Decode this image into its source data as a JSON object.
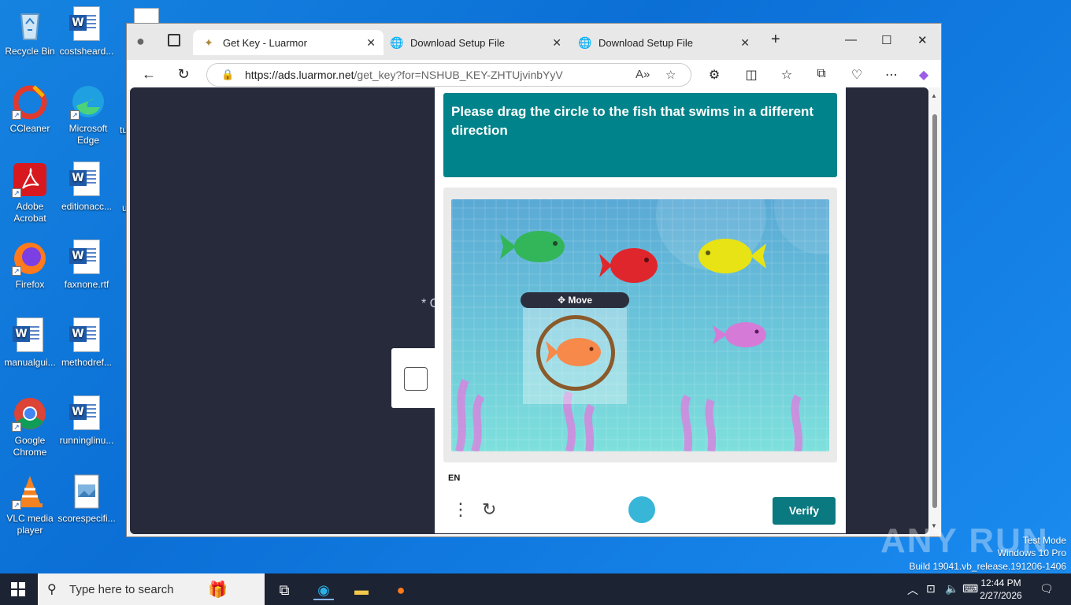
{
  "desktop": {
    "icons": [
      {
        "label": "Recycle Bin"
      },
      {
        "label": "costsheard..."
      },
      {
        "label": "CCleaner"
      },
      {
        "label": "Microsoft Edge"
      },
      {
        "label": "Adobe Acrobat"
      },
      {
        "label": "editionacc..."
      },
      {
        "label": "Firefox"
      },
      {
        "label": "faxnone.rtf"
      },
      {
        "label": "manualgui..."
      },
      {
        "label": "methodref..."
      },
      {
        "label": "Google Chrome"
      },
      {
        "label": "runninglinu..."
      },
      {
        "label": "VLC media player"
      },
      {
        "label": "scorespecifi..."
      }
    ],
    "partial_labels": [
      "tu",
      "u"
    ]
  },
  "browser": {
    "tabs": [
      {
        "title": "Get Key - Luarmor",
        "active": true
      },
      {
        "title": "Download Setup File",
        "active": false
      },
      {
        "title": "Download Setup File",
        "active": false
      }
    ],
    "url": {
      "host": "https://ads.luarmor.net",
      "path": "/get_key?for=NSHUB_KEY-ZHTUjvinbYyV"
    }
  },
  "page": {
    "side_text": "* C",
    "captcha": {
      "prompt": "Please drag the circle to the fish that swims in a different direction",
      "move_label": "Move",
      "language": "EN",
      "verify_label": "Verify"
    }
  },
  "taskbar": {
    "search_placeholder": "Type here to search",
    "time": "12:44 PM",
    "date": "2/27/2026"
  },
  "watermark": {
    "line1": "Test Mode",
    "line2": "Windows 10 Pro",
    "line3": "Build 19041.vb_release.191206-1406",
    "brand": "ANY RUN"
  },
  "colors": {
    "prompt_bg": "#00838a",
    "verify_bg": "#0b7a80",
    "page_bg": "#262a3b",
    "taskbar_bg": "#1c2333"
  }
}
